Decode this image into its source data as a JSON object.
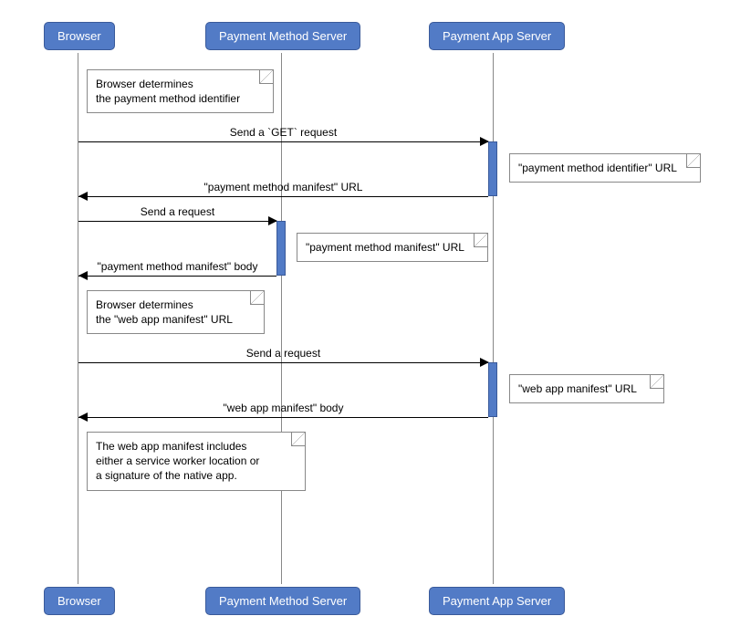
{
  "participants": {
    "browser": "Browser",
    "pms": "Payment Method Server",
    "pas": "Payment App Server"
  },
  "notes": {
    "n1_l1": "Browser determines",
    "n1_l2": "the payment method identifier",
    "n2": "\"payment method identifier\" URL",
    "n3": "\"payment method manifest\" URL",
    "n4_l1": "Browser determines",
    "n4_l2": "the \"web app manifest\" URL",
    "n5": "\"web app manifest\" URL",
    "n6_l1": "The web app manifest includes",
    "n6_l2": "either a service worker location or",
    "n6_l3": "a signature of the native app."
  },
  "messages": {
    "m1": "Send a `GET` request",
    "m2": "\"payment method manifest\" URL",
    "m3": "Send a request",
    "m4": "\"payment method manifest\" body",
    "m5": "Send a request",
    "m6": "\"web app manifest\" body"
  }
}
